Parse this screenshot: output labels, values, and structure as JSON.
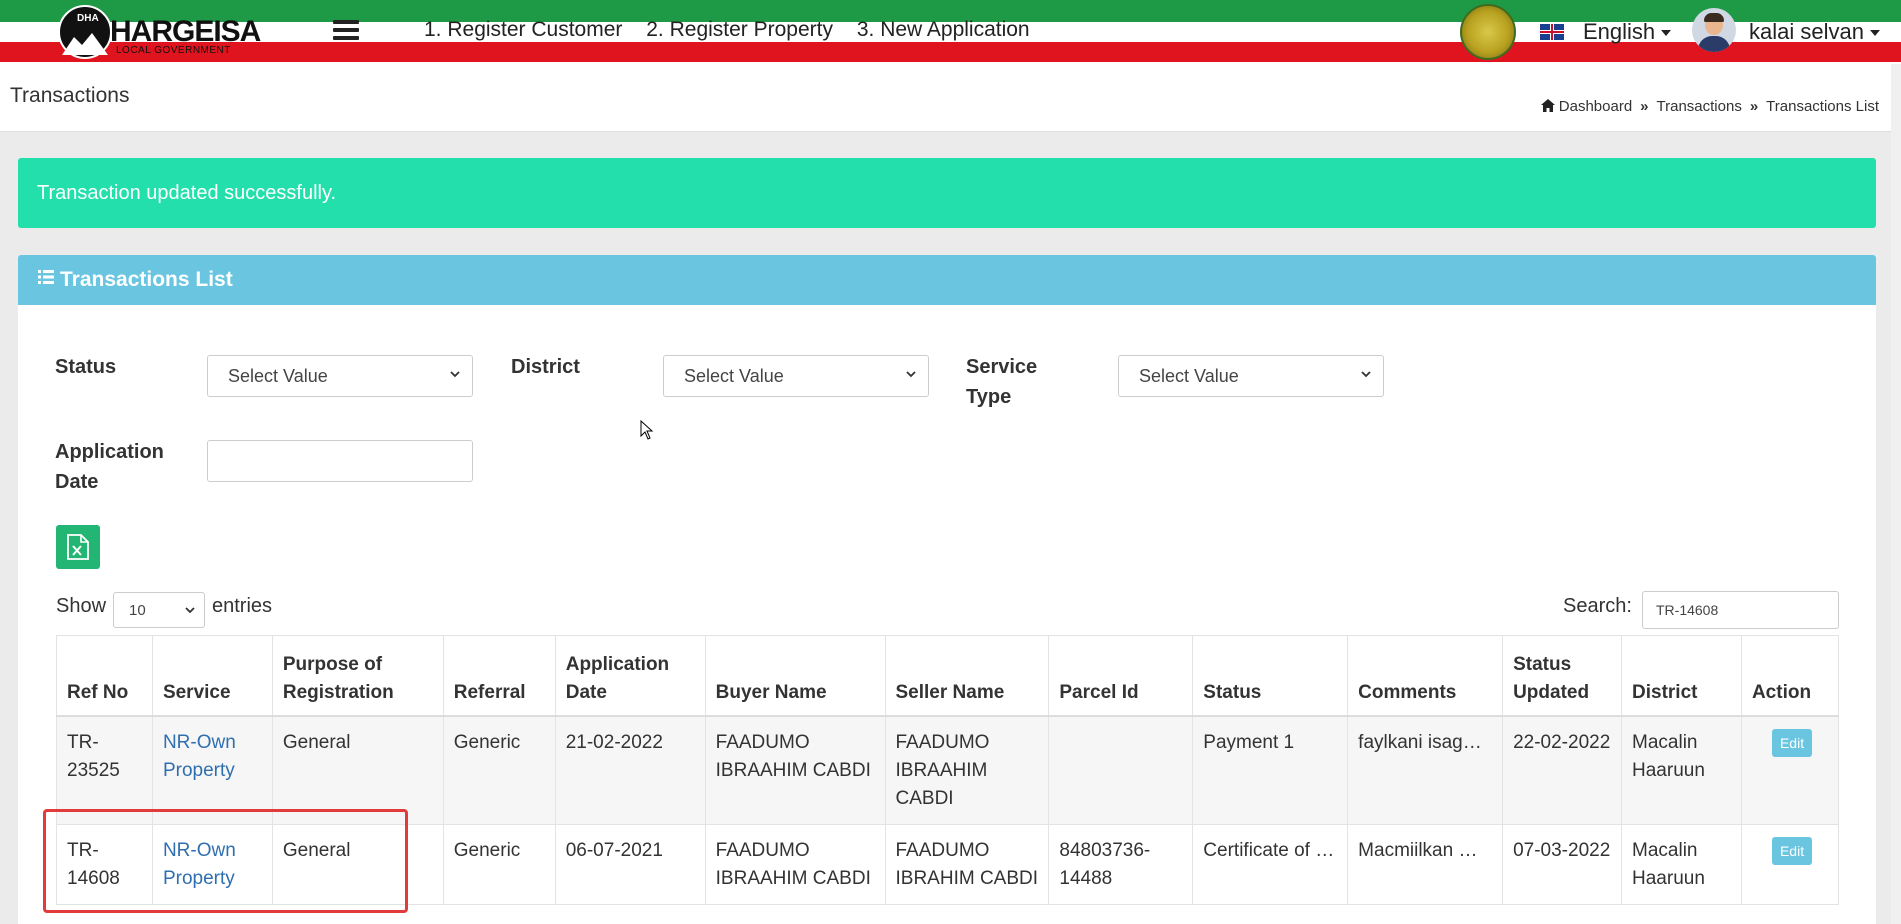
{
  "header": {
    "logo_title": "HARGEISA",
    "logo_subtitle": "LOCAL GOVERNMENT",
    "logo_badge": "DHA",
    "nav": [
      "1. Register Customer",
      "2. Register Property",
      "3. New Application"
    ],
    "language": "English",
    "user": "kalai selvan"
  },
  "page": {
    "title": "Transactions",
    "breadcrumb": [
      "Dashboard",
      "Transactions",
      "Transactions List"
    ]
  },
  "alert": {
    "message": "Transaction updated successfully."
  },
  "card": {
    "title": "Transactions List"
  },
  "filters": {
    "status_label": "Status",
    "status_value": "Select Value",
    "district_label": "District",
    "district_value": "Select Value",
    "service_type_label_1": "Service",
    "service_type_label_2": "Type",
    "service_type_value": "Select Value",
    "application_date_label_1": "Application",
    "application_date_label_2": "Date",
    "application_date_value": ""
  },
  "table_controls": {
    "show": "Show",
    "entries_value": "10",
    "entries": "entries",
    "search_label": "Search:",
    "search_value": "TR-14608"
  },
  "table": {
    "columns": [
      "Ref No",
      "Service",
      "Purpose of Registration",
      "Referral",
      "Application Date",
      "Buyer Name",
      "Seller Name",
      "Parcel Id",
      "Status",
      "Comments",
      "Status Updated",
      "District",
      "Action"
    ],
    "rows": [
      {
        "ref_no": "TR-23525",
        "service": "NR-Own Property",
        "purpose": "General",
        "referral": "Generic",
        "application_date": "21-02-2022",
        "buyer": "FAADUMO IBRAAHIM CABDI",
        "seller": "FAADUMO IBRAAHIM CABDI",
        "parcel_id": "",
        "status": "Payment 1",
        "comments": "faylkani isag…",
        "status_updated": "22-02-2022",
        "district": "Macalin Haaruun",
        "action": "Edit"
      },
      {
        "ref_no": "TR-14608",
        "service": "NR-Own Property",
        "purpose": "General",
        "referral": "Generic",
        "application_date": "06-07-2021",
        "buyer": "FAADUMO IBRAAHIM CABDI",
        "seller": "FAADUMO IBRAHIM CABDI",
        "parcel_id": "84803736-14488",
        "status": "Certificate of …",
        "comments": "Macmiilkan …",
        "status_updated": "07-03-2022",
        "district": "Macalin Haaruun",
        "action": "Edit"
      }
    ]
  },
  "colors": {
    "alert_bg": "#22dfab",
    "card_header_bg": "#69c5e0",
    "link": "#2f6fb0",
    "highlight": "#e23b3b",
    "flag_green": "#1e9a46",
    "flag_red": "#e0141e"
  }
}
